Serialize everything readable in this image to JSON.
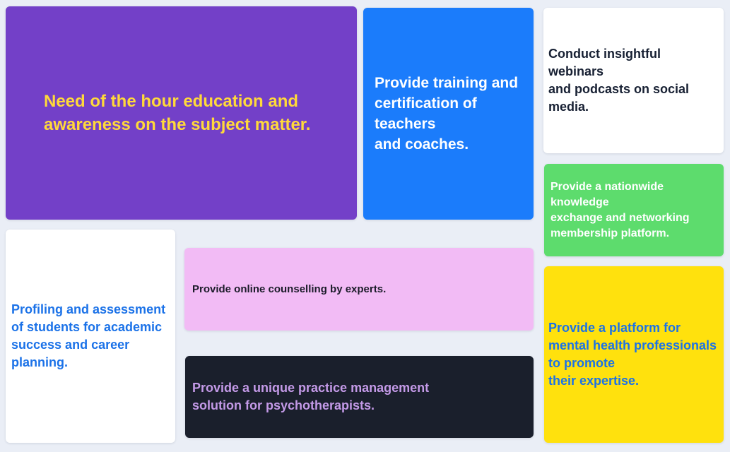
{
  "cards": {
    "education": {
      "text": "Need of the hour education and\nawareness on the subject matter.",
      "bg": "#7340c8",
      "color": "#ffd93a"
    },
    "training": {
      "text": "Provide training and\ncertification of\nteachers\nand coaches.",
      "bg": "#1b7cfb",
      "color": "#ffffff"
    },
    "webinars": {
      "text": "Conduct insightful\nwebinars\nand podcasts on social\nmedia.",
      "bg": "#ffffff",
      "color": "#172033"
    },
    "networking": {
      "text": "Provide a nationwide\nknowledge\nexchange and networking\nmembership platform.",
      "bg": "#5ddc6d",
      "color": "#ffffff"
    },
    "profiling": {
      "text": "Profiling and assessment\nof students for academic\nsuccess and career\nplanning.",
      "bg": "#ffffff",
      "color": "#1b72e8"
    },
    "counselling": {
      "text": "Provide online counselling by experts.",
      "bg": "#f2bbf5",
      "color": "#1c1c2a"
    },
    "practice": {
      "text": "Provide a unique practice management\nsolution for psychotherapists.",
      "bg": "#1a1f2c",
      "color": "#c49ae8"
    },
    "platform": {
      "text": "Provide a platform for\nmental health professionals\nto promote\ntheir expertise.",
      "bg": "#ffe10d",
      "color": "#1b72e8"
    }
  }
}
